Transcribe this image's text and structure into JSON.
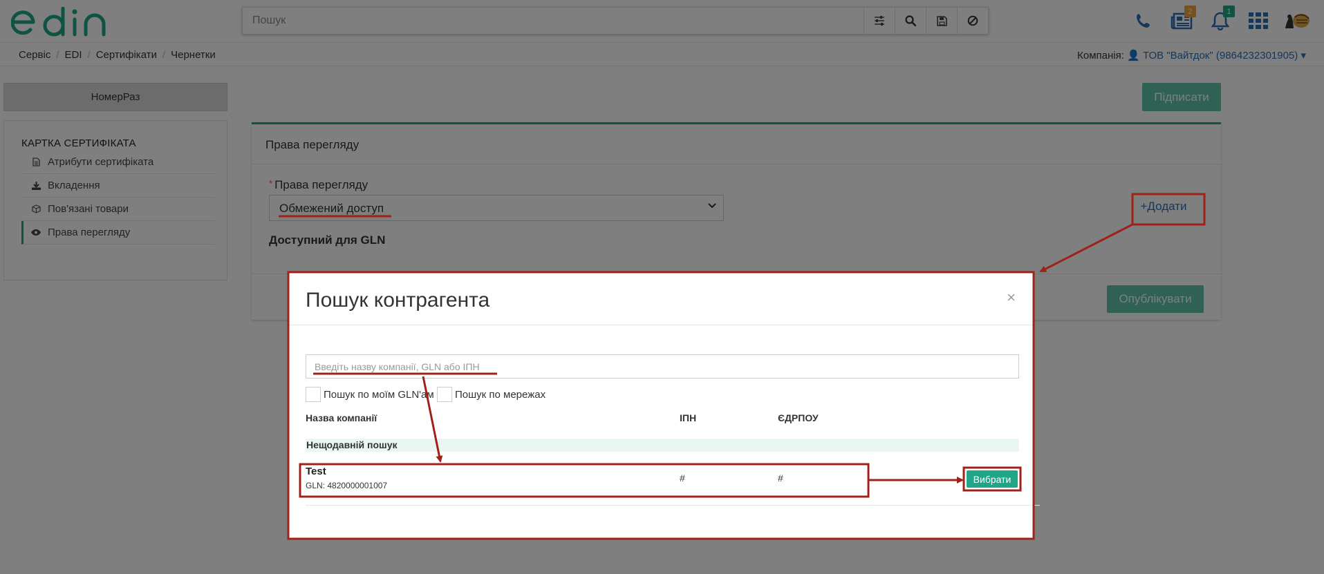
{
  "header": {
    "logo_text": "edin",
    "search_placeholder": "Пошук",
    "search_buttons": [
      "filter-icon",
      "search-icon",
      "save-icon",
      "clear-icon"
    ],
    "notifications": {
      "news_count": "2",
      "bell_count": "1"
    }
  },
  "breadcrumb": [
    "Сервіс",
    "EDI",
    "Сертифікати",
    "Чернетки"
  ],
  "company": {
    "label": "Компанія:",
    "value": "ТОВ \"Вайтдок\" (9864232301905)"
  },
  "sidebar": {
    "top_button": "НомерРаз",
    "card_title": "КАРТКА СЕРТИФІКАТА",
    "items": [
      {
        "label": "Атрибути сертифіката",
        "icon": "document-icon"
      },
      {
        "label": "Вкладення",
        "icon": "download-icon"
      },
      {
        "label": "Пов'язані товари",
        "icon": "box-icon"
      },
      {
        "label": "Права перегляду",
        "icon": "eye-icon"
      }
    ]
  },
  "actions": {
    "sign": "Підписати",
    "publish": "Опублікувати"
  },
  "panel": {
    "title": "Права перегляду",
    "field_label": "Права перегляду",
    "required_mark": "*",
    "select_value": "Обмежений доступ",
    "gln_label": "Доступний для GLN",
    "add_button": "+Додати"
  },
  "modal": {
    "title": "Пошук контрагента",
    "close": "×",
    "input_placeholder": "Введіть назву компанії, GLN або ІПН",
    "checkbox_my_gln": "Пошук по моїм GLN'ам",
    "checkbox_networks": "Пошук по мережах",
    "columns": {
      "name": "Назва компанії",
      "ipn": "ІПН",
      "edrpou": "ЄДРПОУ"
    },
    "recent_label": "Нещодавній пошук",
    "rows": [
      {
        "name": "Test",
        "gln": "GLN: 4820000001007",
        "ipn": "#",
        "edrpou": "#",
        "action": "Вибрати"
      }
    ]
  },
  "colors": {
    "accent": "#1fa686",
    "accent_light": "#5fc2ab",
    "link": "#2a6fb5",
    "annotation": "#a0201a"
  }
}
